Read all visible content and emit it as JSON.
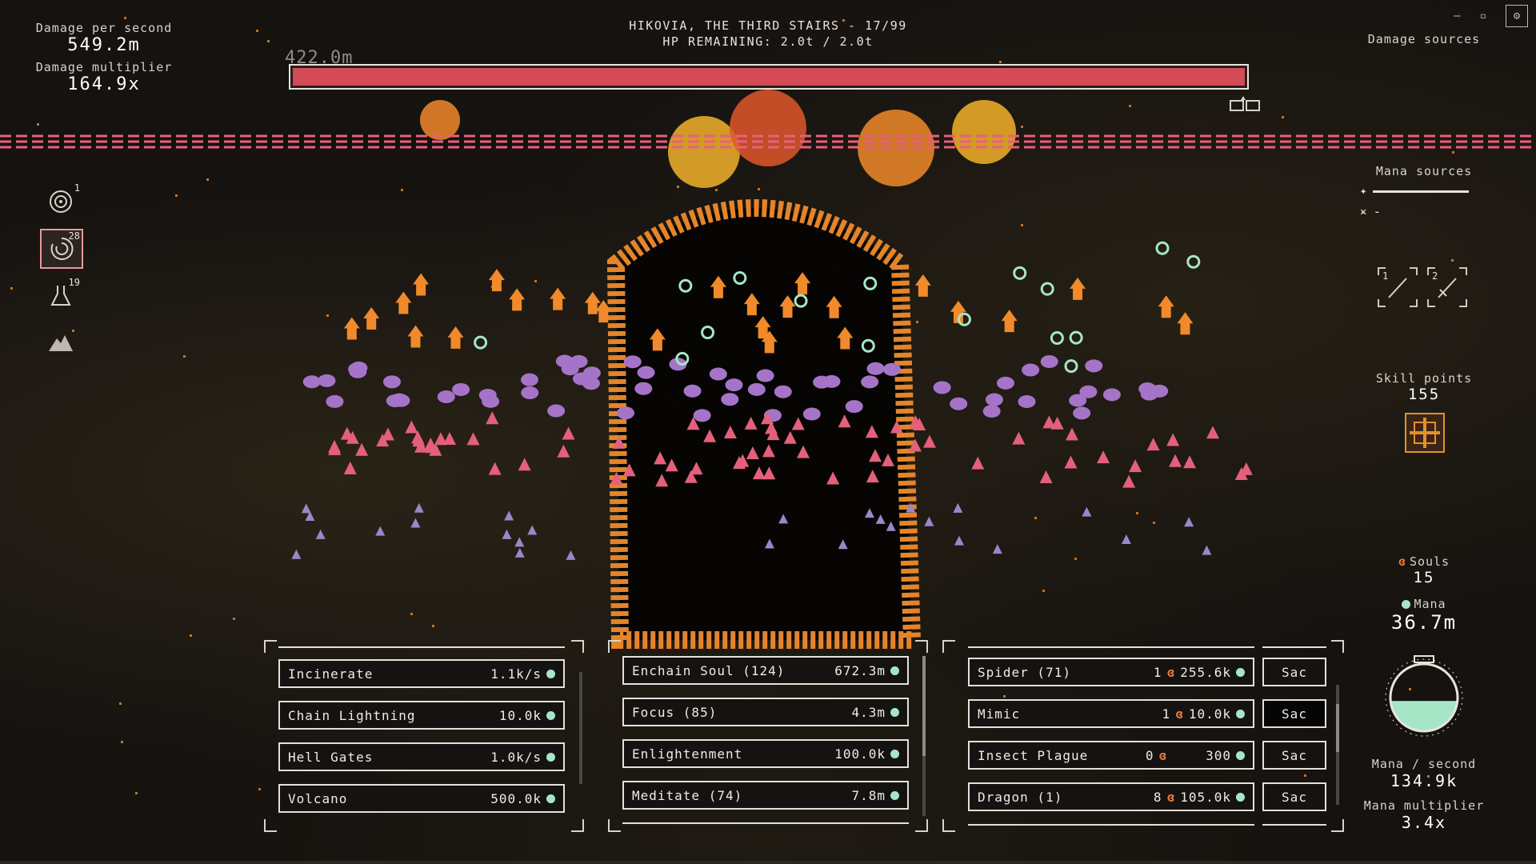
{
  "stats": {
    "dps_label": "Damage per second",
    "dps_value": "549.2m",
    "mult_label": "Damage multiplier",
    "mult_value": "164.9x"
  },
  "boss": {
    "title": "HIKOVIA, THE THIRD STAIRS - 17/99",
    "hp_text": "HP REMAINING: 2.0t / 2.0t",
    "hp_fraction": 1.0,
    "distance": "422.0m"
  },
  "right": {
    "damage_sources": "Damage sources",
    "mana_sources": "Mana sources",
    "mana_source_2": "-",
    "weapon_slots": [
      "1",
      "2"
    ],
    "skill_points_label": "Skill points",
    "skill_points_value": "155",
    "souls_label": "Souls",
    "souls_value": "15",
    "mana_label": "Mana",
    "mana_value": "36.7m",
    "mana_fill_fraction": 0.45,
    "mana_rate_label": "Mana / second",
    "mana_rate_value": "134.9k",
    "mana_mult_label": "Mana multiplier",
    "mana_mult_value": "3.4x"
  },
  "abilities": [
    {
      "icon": "target-icon",
      "count": "1"
    },
    {
      "icon": "vortex-icon",
      "count": "28"
    },
    {
      "icon": "flask-icon",
      "count": "19"
    },
    {
      "icon": "mountain-icon",
      "count": ""
    }
  ],
  "spells": [
    {
      "name": "Incinerate",
      "value": "1.1k/s"
    },
    {
      "name": "Chain Lightning",
      "value": "10.0k"
    },
    {
      "name": "Hell Gates",
      "value": "1.0k/s"
    },
    {
      "name": "Volcano",
      "value": "500.0k"
    }
  ],
  "upgrades": [
    {
      "name": "Enchain Soul (124)",
      "value": "672.3m"
    },
    {
      "name": "Focus (85)",
      "value": "4.3m"
    },
    {
      "name": "Enlightenment",
      "value": "100.0k"
    },
    {
      "name": "Meditate (74)",
      "value": "7.8m"
    }
  ],
  "minions": [
    {
      "name": "Spider (71)",
      "souls": "1",
      "value": "255.6k",
      "action": "Sac"
    },
    {
      "name": "Mimic",
      "souls": "1",
      "value": "10.0k",
      "action": "Sac"
    },
    {
      "name": "Insect Plague",
      "souls": "0",
      "value": "300",
      "action": "Sac"
    },
    {
      "name": "Dragon (1)",
      "souls": "8",
      "value": "105.0k",
      "action": "Sac"
    }
  ],
  "colors": {
    "hp": "#d24b55",
    "mana": "#a6e6c6",
    "track": "#e8607a",
    "fire": "#f08a2a",
    "purple": "#a574c8",
    "pink": "#e4607a"
  }
}
